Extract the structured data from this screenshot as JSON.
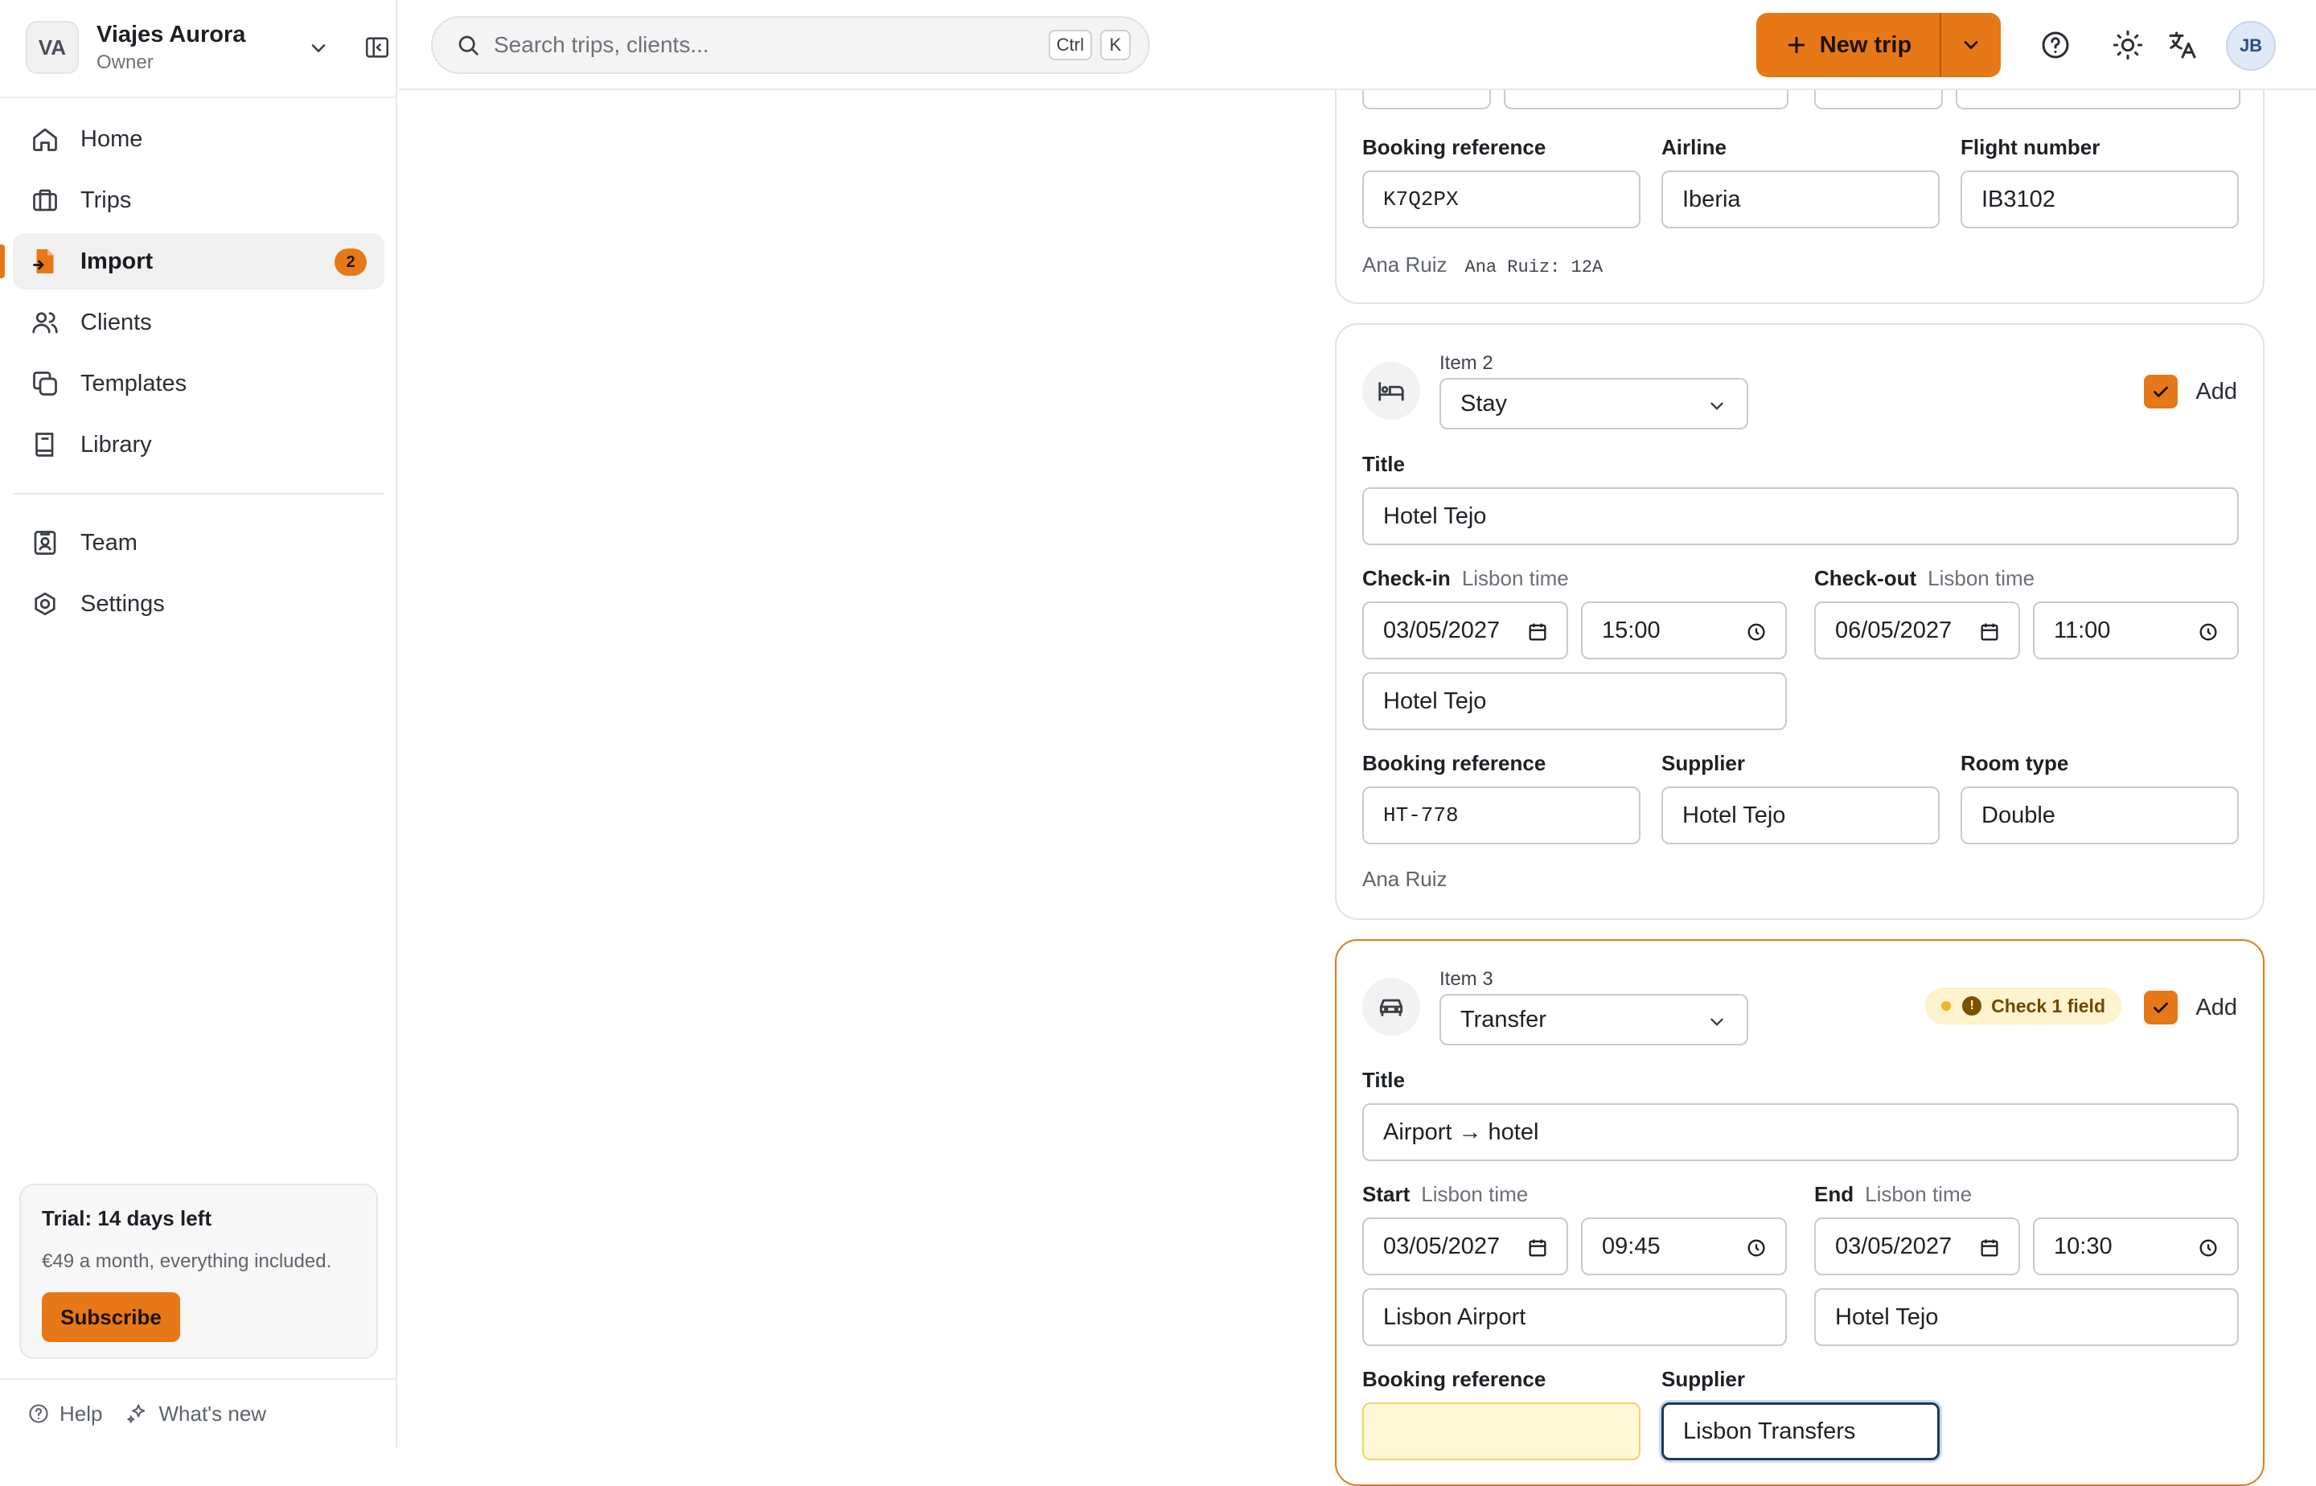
{
  "workspace": {
    "initials": "VA",
    "name": "Viajes Aurora",
    "role": "Owner"
  },
  "nav": {
    "items": [
      {
        "label": "Home",
        "icon": "home-icon"
      },
      {
        "label": "Trips",
        "icon": "briefcase-icon"
      },
      {
        "label": "Import",
        "icon": "file-import-icon",
        "badge": "2",
        "active": true
      },
      {
        "label": "Clients",
        "icon": "users-icon"
      },
      {
        "label": "Templates",
        "icon": "copy-icon"
      },
      {
        "label": "Library",
        "icon": "book-icon"
      }
    ],
    "secondary": [
      {
        "label": "Team",
        "icon": "id-badge-icon"
      },
      {
        "label": "Settings",
        "icon": "gear-icon"
      }
    ]
  },
  "trial": {
    "title": "Trial: 14 days left",
    "subtitle": "€49 a month, everything included.",
    "button": "Subscribe"
  },
  "footer": {
    "help": "Help",
    "whats_new": "What's new"
  },
  "topbar": {
    "search_placeholder": "Search trips, clients...",
    "shortcut_mod": "Ctrl",
    "shortcut_key": "K",
    "new_trip": "New trip",
    "user_initials": "JB"
  },
  "colors": {
    "accent": "#e67817",
    "warn_bg": "#fef8d8"
  },
  "item1": {
    "booking_ref_label": "Booking reference",
    "booking_ref": "K7Q2PX",
    "airline_label": "Airline",
    "airline": "Iberia",
    "flight_label": "Flight number",
    "flight": "IB3102",
    "traveller": "Ana Ruiz",
    "seat": "Ana Ruiz: 12A"
  },
  "item2": {
    "item_label": "Item 2",
    "type": "Stay",
    "add_label": "Add",
    "title_label": "Title",
    "title": "Hotel Tejo",
    "checkin_label": "Check-in",
    "checkout_label": "Check-out",
    "tz_label": "Lisbon time",
    "checkin_date": "03/05/2027",
    "checkin_time": "15:00",
    "checkout_date": "06/05/2027",
    "checkout_time": "11:00",
    "location": "Hotel Tejo",
    "booking_ref_label": "Booking reference",
    "booking_ref": "HT-778",
    "supplier_label": "Supplier",
    "supplier": "Hotel Tejo",
    "room_label": "Room type",
    "room": "Double",
    "traveller": "Ana Ruiz"
  },
  "item3": {
    "item_label": "Item 3",
    "type": "Transfer",
    "add_label": "Add",
    "warning": "Check 1 field",
    "title_label": "Title",
    "title": "Airport → hotel",
    "start_label": "Start",
    "end_label": "End",
    "tz_label": "Lisbon time",
    "start_date": "03/05/2027",
    "start_time": "09:45",
    "end_date": "03/05/2027",
    "end_time": "10:30",
    "from": "Lisbon Airport",
    "to": "Hotel Tejo",
    "booking_ref_label": "Booking reference",
    "booking_ref": "",
    "supplier_label": "Supplier",
    "supplier": "Lisbon Transfers"
  }
}
